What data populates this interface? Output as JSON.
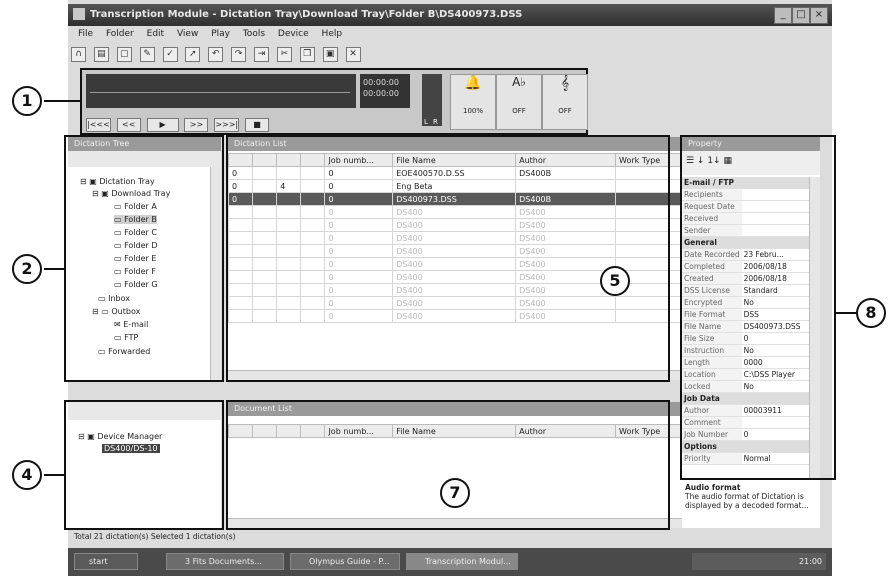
{
  "window": {
    "title": "Transcription Module - Dictation Tray\\Download Tray\\Folder B\\DS400973.DSS"
  },
  "menu": [
    "File",
    "Folder",
    "Edit",
    "View",
    "Play",
    "Tools",
    "Device",
    "Help"
  ],
  "player": {
    "time_total": "00:00:00",
    "time_pos": "00:00:00",
    "meter_labels": [
      "L",
      "R"
    ],
    "knobs": [
      {
        "value": "100%"
      },
      {
        "value": "OFF"
      },
      {
        "value": "OFF"
      }
    ],
    "transport": [
      "|<<<",
      "<<",
      "▶",
      ">>",
      ">>>|",
      "■"
    ]
  },
  "dictation_tree": {
    "title": "Dictation Tree",
    "items": [
      "Dictation Tray",
      "Download Tray",
      "Folder A",
      "Folder B",
      "Folder C",
      "Folder D",
      "Folder E",
      "Folder F",
      "Folder G",
      "Inbox",
      "Outbox",
      "E-mail",
      "FTP",
      "Forwarded"
    ]
  },
  "device_tree": {
    "items": [
      "Device Manager",
      "DS400/DS-10"
    ]
  },
  "dictation_list": {
    "title": "Dictation List",
    "columns": [
      "",
      "",
      "",
      "",
      "Job numb...",
      "File Name",
      "Author",
      "Work Type"
    ],
    "rows": [
      [
        "0",
        "",
        "",
        "",
        "0",
        "EOE400570.D.SS",
        "DS400B",
        ""
      ],
      [
        "0",
        "",
        "4",
        "",
        "0",
        "Eng Beta",
        "",
        ""
      ],
      [
        "0",
        "",
        "",
        "",
        "0",
        "DS400973.DSS",
        "DS400B",
        ""
      ],
      [
        "",
        "",
        "",
        "",
        "0",
        "DS400",
        "DS400",
        ""
      ],
      [
        "",
        "",
        "",
        "",
        "0",
        "DS400",
        "DS400",
        ""
      ],
      [
        "",
        "",
        "",
        "",
        "0",
        "DS400",
        "DS400",
        ""
      ],
      [
        "",
        "",
        "",
        "",
        "0",
        "DS400",
        "DS400",
        ""
      ],
      [
        "",
        "",
        "",
        "",
        "0",
        "DS400",
        "DS400",
        ""
      ],
      [
        "",
        "",
        "",
        "",
        "0",
        "DS400",
        "DS400",
        ""
      ],
      [
        "",
        "",
        "",
        "",
        "0",
        "DS400",
        "DS400",
        ""
      ],
      [
        "",
        "",
        "",
        "",
        "0",
        "DS400",
        "DS400",
        ""
      ],
      [
        "",
        "",
        "",
        "",
        "0",
        "DS400",
        "DS400",
        ""
      ]
    ]
  },
  "document_list": {
    "title": "Document List",
    "columns": [
      "",
      "",
      "",
      "",
      "Job numb...",
      "File Name",
      "Author",
      "Work Type"
    ]
  },
  "property": {
    "title": "Property",
    "groups": [
      {
        "name": "E-mail / FTP",
        "rows": [
          [
            "Recipients",
            ""
          ],
          [
            "Request Date",
            ""
          ],
          [
            "Received",
            ""
          ],
          [
            "Sender",
            ""
          ]
        ]
      },
      {
        "name": "General",
        "rows": [
          [
            "Date Recorded",
            "23 Febru..."
          ],
          [
            "Completed",
            "2006/08/18"
          ],
          [
            "Created",
            "2006/08/18"
          ],
          [
            "DSS License",
            "Standard"
          ],
          [
            "Encrypted",
            "No"
          ],
          [
            "File Format",
            "DSS"
          ],
          [
            "File Name",
            "DS400973.DSS"
          ],
          [
            "File Size",
            "0"
          ],
          [
            "Instruction",
            "No"
          ],
          [
            "Length",
            "0000"
          ],
          [
            "Location",
            "C:\\DSS Player"
          ],
          [
            "Locked",
            "No"
          ]
        ]
      },
      {
        "name": "Job Data",
        "rows": [
          [
            "Author",
            "00003911"
          ],
          [
            "Comment",
            ""
          ],
          [
            "Job Number",
            "0"
          ]
        ]
      },
      {
        "name": "Options",
        "rows": [
          [
            "Priority",
            "Normal"
          ]
        ]
      }
    ],
    "desc_title": "Audio format",
    "desc_text": "The audio format of Dictation is displayed by a decoded format..."
  },
  "status": {
    "text": "Total 21 dictation(s)  Selected 1 dictation(s)"
  },
  "taskbar": {
    "start": "start",
    "tasks": [
      "3 Fits Documents...",
      "Olympus Guide - P...",
      "Transcription Modul..."
    ],
    "clock": "21:00"
  },
  "callouts": [
    "1",
    "2",
    "4",
    "5",
    "7",
    "8"
  ]
}
